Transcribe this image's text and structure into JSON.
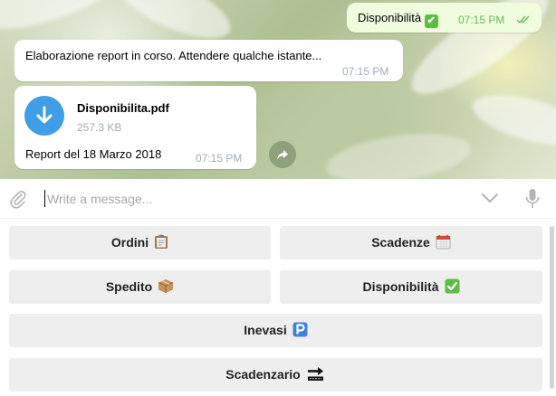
{
  "messages": {
    "outgoing": {
      "text": "Disponibilità",
      "emoji": "✔",
      "time": "07:15 PM",
      "status_icon": "double-check-icon"
    },
    "processing": {
      "text": "Elaborazione report in corso. Attendere qualche istante...",
      "time": "07:15 PM"
    },
    "file": {
      "name": "Disponibilita.pdf",
      "size": "257.3 KB",
      "caption": "Report del 18 Marzo 2018",
      "time": "07:15 PM",
      "icon": "download-arrow-icon"
    }
  },
  "composer": {
    "placeholder": "Write a message...",
    "value": ""
  },
  "keyboard": {
    "buttons": [
      {
        "label": "Ordini",
        "icon": "clipboard-emoji"
      },
      {
        "label": "Scadenze",
        "icon": "calendar-emoji"
      },
      {
        "label": "Spedito",
        "icon": "package-emoji"
      },
      {
        "label": "Disponibilità",
        "icon": "check-mark-emoji"
      },
      {
        "label": "Inevasi",
        "icon": "parking-emoji"
      },
      {
        "label": "Scadenzario",
        "icon": "soon-arrow-emoji"
      }
    ]
  },
  "colors": {
    "outgoing_bubble": "#effdde",
    "time_outgoing": "#6cb85f",
    "file_icon": "#3f9ee5",
    "keyboard_button": "#eeeeee"
  }
}
